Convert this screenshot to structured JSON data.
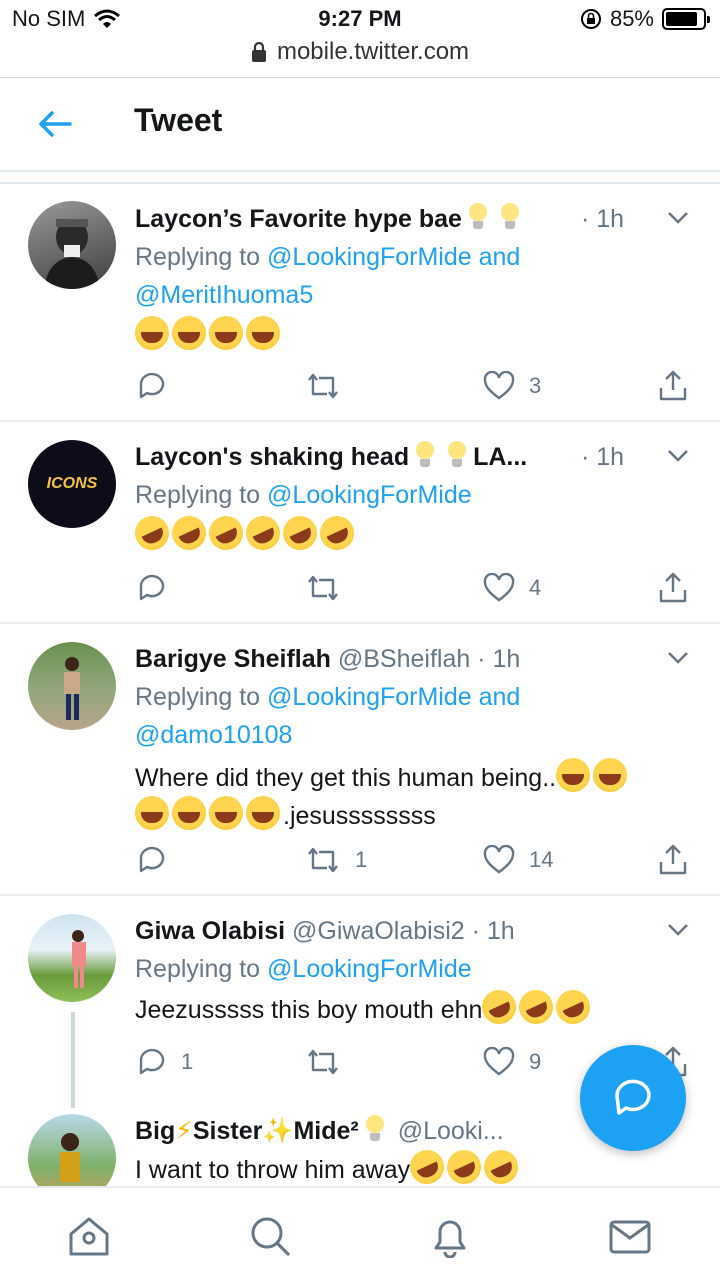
{
  "status_bar": {
    "carrier": "No SIM",
    "time": "9:27 PM",
    "battery": "85%",
    "battery_level": 0.85
  },
  "browser": {
    "url": "mobile.twitter.com"
  },
  "header": {
    "title": "Tweet"
  },
  "tweets": [
    {
      "name": "Laycon’s Favorite hype bae",
      "handle": "",
      "time": "· 1h",
      "reply_prefix": "Replying to",
      "mention1": "@LookingForMide",
      "and": "and",
      "mention2": "@MeritIhuoma5",
      "text": "",
      "emoji": "😂😂😂😂",
      "replies": "",
      "retweets": "",
      "likes": "3"
    },
    {
      "name": "Laycon's shaking head",
      "name_suffix": "LA...",
      "handle": "",
      "time": "· 1h",
      "reply_prefix": "Replying to",
      "mention1": "@LookingForMide",
      "emoji": "🤣🤣🤣🤣🤣🤣",
      "avatar_text": "ICONS",
      "replies": "",
      "retweets": "",
      "likes": "4"
    },
    {
      "name": "Barigye Sheiflah",
      "handle": "@BSheiflah",
      "time": "· 1h",
      "reply_prefix": "Replying to",
      "mention1": "@LookingForMide",
      "and": "and",
      "mention2": "@damo10108",
      "text_line1": "Where did they get this human being..",
      "text_line2": ".jesussssssss",
      "replies": "",
      "retweets": "1",
      "likes": "14"
    },
    {
      "name": "Giwa Olabisi",
      "handle": "@GiwaOlabisi2",
      "time": "· 1h",
      "reply_prefix": "Replying to",
      "mention1": "@LookingForMide",
      "text": "Jeezusssss this boy mouth ehn",
      "replies": "1",
      "retweets": "",
      "likes": "9"
    },
    {
      "name_part1": "Big",
      "name_part2": "Sister",
      "name_part3": "Mide²",
      "handle": "@Looki...",
      "text": "I want to throw him away"
    }
  ],
  "colors": {
    "accent": "#1da1f2",
    "secondary_text": "#657786",
    "divider": "#e6ecf0"
  },
  "icons": [
    "back-arrow-icon",
    "lock-icon",
    "wifi-icon",
    "reply-icon",
    "retweet-icon",
    "like-icon",
    "share-icon",
    "caret-down-icon",
    "compose-icon",
    "home-icon",
    "search-icon",
    "notifications-icon",
    "messages-icon"
  ]
}
